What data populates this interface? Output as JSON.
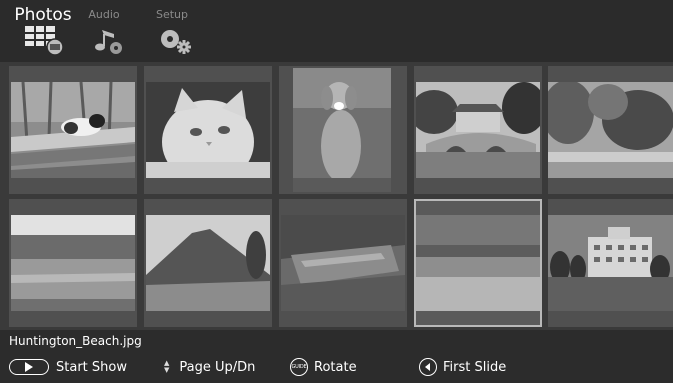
{
  "tabs": [
    {
      "label": "Photos",
      "icon": "photo-grid-icon",
      "active": true
    },
    {
      "label": "Audio",
      "icon": "music-note-icon",
      "active": false
    },
    {
      "label": "Setup",
      "icon": "setup-gears-icon",
      "active": false
    }
  ],
  "photos": [
    {
      "subject": "cat-on-logs",
      "selected": false
    },
    {
      "subject": "white-cat",
      "selected": false
    },
    {
      "subject": "sitting-dog",
      "selected": false
    },
    {
      "subject": "bridge-gate",
      "selected": false
    },
    {
      "subject": "park-trees",
      "selected": false
    },
    {
      "subject": "lake-forest",
      "selected": false
    },
    {
      "subject": "mountain",
      "selected": false
    },
    {
      "subject": "tree-bark",
      "selected": false
    },
    {
      "subject": "beach",
      "selected": true
    },
    {
      "subject": "hotel-building",
      "selected": false
    }
  ],
  "selected_filename": "Huntington_Beach.jpg",
  "footer": {
    "start_show": "Start Show",
    "page_up_dn": "Page Up/Dn",
    "rotate": "Rotate",
    "rotate_button_text": "GUIDE",
    "first_slide": "First Slide"
  },
  "colors": {
    "background": "#2c2c2c",
    "grid_background": "#3a3a3a",
    "cell": "#505050",
    "selection_outline": "#b9b9b9"
  }
}
